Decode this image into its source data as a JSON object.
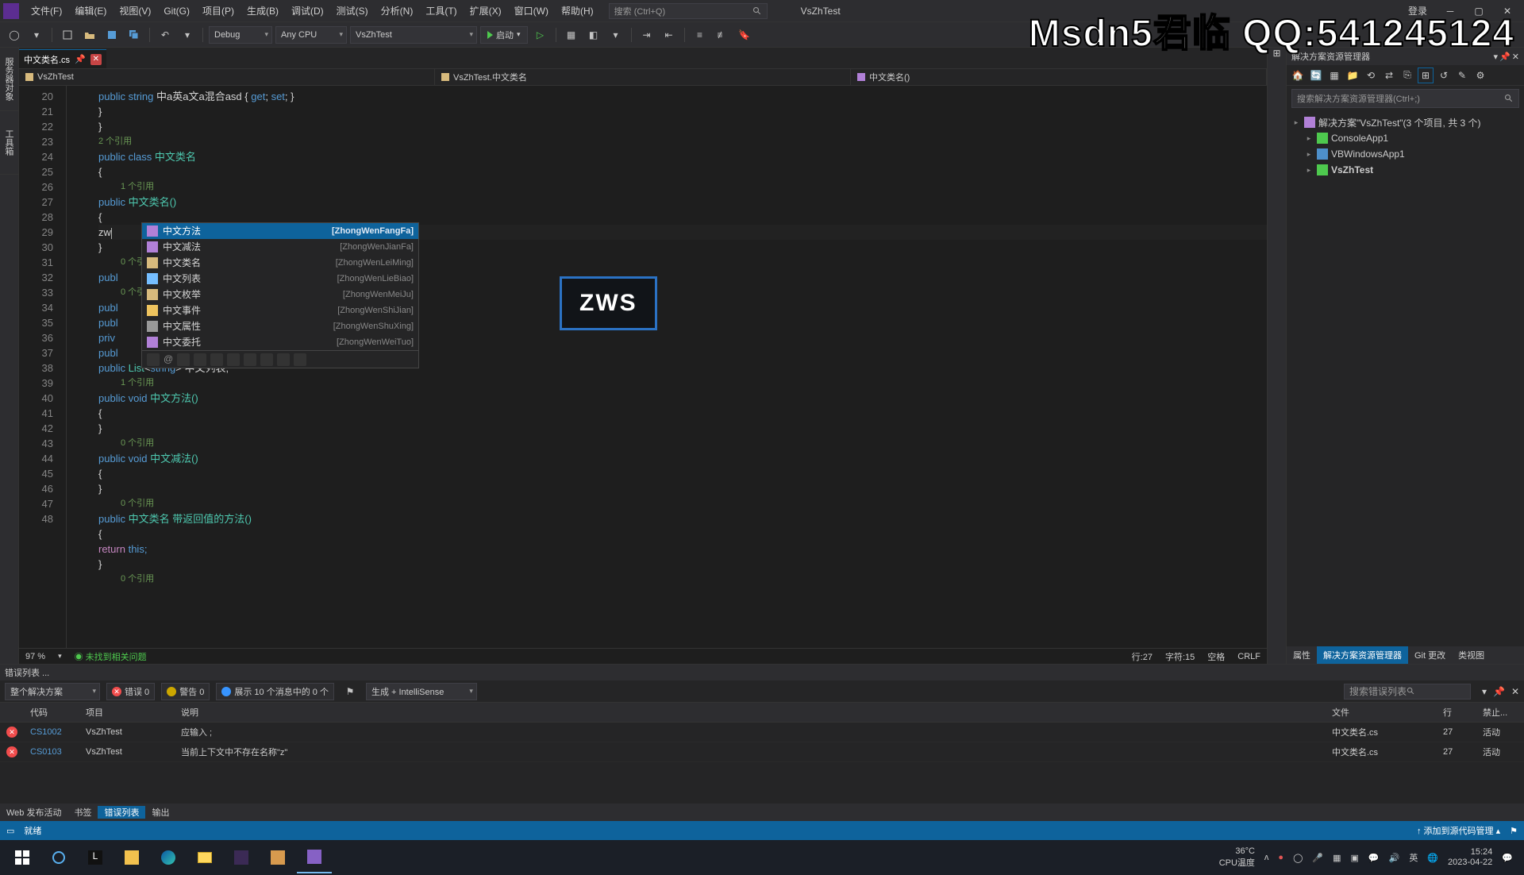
{
  "menu": {
    "items": [
      "文件(F)",
      "编辑(E)",
      "视图(V)",
      "Git(G)",
      "项目(P)",
      "生成(B)",
      "调试(D)",
      "测试(S)",
      "分析(N)",
      "工具(T)",
      "扩展(X)",
      "窗口(W)",
      "帮助(H)"
    ],
    "search_placeholder": "搜索 (Ctrl+Q)",
    "title": "VsZhTest",
    "login": "登录"
  },
  "toolbar": {
    "config": "Debug",
    "platform": "Any CPU",
    "startup": "VsZhTest",
    "run": "启动"
  },
  "file_tab": {
    "label": "中文类名.cs"
  },
  "nav": {
    "project": "VsZhTest",
    "class": "VsZhTest.中文类名",
    "method": "中文类名()"
  },
  "lines": {
    "start": 20,
    "end": 48
  },
  "code": {
    "l20_prop": "中a英a文a混合asd",
    "hint_2ref": "2 个引用",
    "hint_1ref": "1 个引用",
    "hint_0ref": "0 个引用",
    "class_name": "中文类名",
    "ctor": "中文类名()",
    "typed": "zw",
    "list_field": "中文列表;",
    "m_method": "中文方法()",
    "m_sub": "中文减法()",
    "m_ret": "带返回值的方法()",
    "ret_this": "this;"
  },
  "intellisense": {
    "items": [
      {
        "name": "中文方法",
        "pinyin": "[ZhongWenFangFa]",
        "sel": true
      },
      {
        "name": "中文减法",
        "pinyin": "[ZhongWenJianFa]"
      },
      {
        "name": "中文类名",
        "pinyin": "[ZhongWenLeiMing]"
      },
      {
        "name": "中文列表",
        "pinyin": "[ZhongWenLieBiao]"
      },
      {
        "name": "中文枚举",
        "pinyin": "[ZhongWenMeiJu]"
      },
      {
        "name": "中文事件",
        "pinyin": "[ZhongWenShiJian]"
      },
      {
        "name": "中文属性",
        "pinyin": "[ZhongWenShuXing]"
      },
      {
        "name": "中文委托",
        "pinyin": "[ZhongWenWeiTuo]"
      }
    ]
  },
  "editor_status": {
    "zoom": "97 %",
    "issues": "未找到相关问题",
    "line": "行:27",
    "col": "字符:15",
    "ins": "空格",
    "crlf": "CRLF"
  },
  "errlist": {
    "title": "错误列表 ...",
    "scope": "整个解决方案",
    "errors": "错误 0",
    "warnings": "警告 0",
    "info": "展示 10 个消息中的 0 个",
    "build": "生成 + IntelliSense",
    "search": "搜索错误列表",
    "cols": {
      "code": "代码",
      "project": "项目",
      "desc": "说明",
      "file": "文件",
      "line": "行",
      "suppress": "禁止..."
    },
    "rows": [
      {
        "code": "CS1002",
        "project": "VsZhTest",
        "desc": "应输入 ;",
        "file": "中文类名.cs",
        "line": "27",
        "sup": "活动"
      },
      {
        "code": "CS0103",
        "project": "VsZhTest",
        "desc": "当前上下文中不存在名称\"z\"",
        "file": "中文类名.cs",
        "line": "27",
        "sup": "活动"
      }
    ],
    "tabs": [
      "Web 发布活动",
      "书签",
      "错误列表",
      "输出"
    ]
  },
  "solution": {
    "title": "解决方案资源管理器",
    "search": "搜索解决方案资源管理器(Ctrl+;)",
    "root": "解决方案\"VsZhTest\"(3 个项目, 共 3 个)",
    "projects": [
      "ConsoleApp1",
      "VBWindowsApp1",
      "VsZhTest"
    ]
  },
  "right_tabs": [
    "属性",
    "解决方案资源管理器",
    "Git 更改",
    "类视图"
  ],
  "status": {
    "ready": "就绪",
    "scm": "添加到源代码管理"
  },
  "overlay": {
    "brand": "Msdn5君临 QQ:541245124",
    "zws": "ZWS"
  },
  "taskbar": {
    "temp": "36°C",
    "cpu": "CPU温度",
    "time": "15:24",
    "date": "2023-04-22"
  }
}
